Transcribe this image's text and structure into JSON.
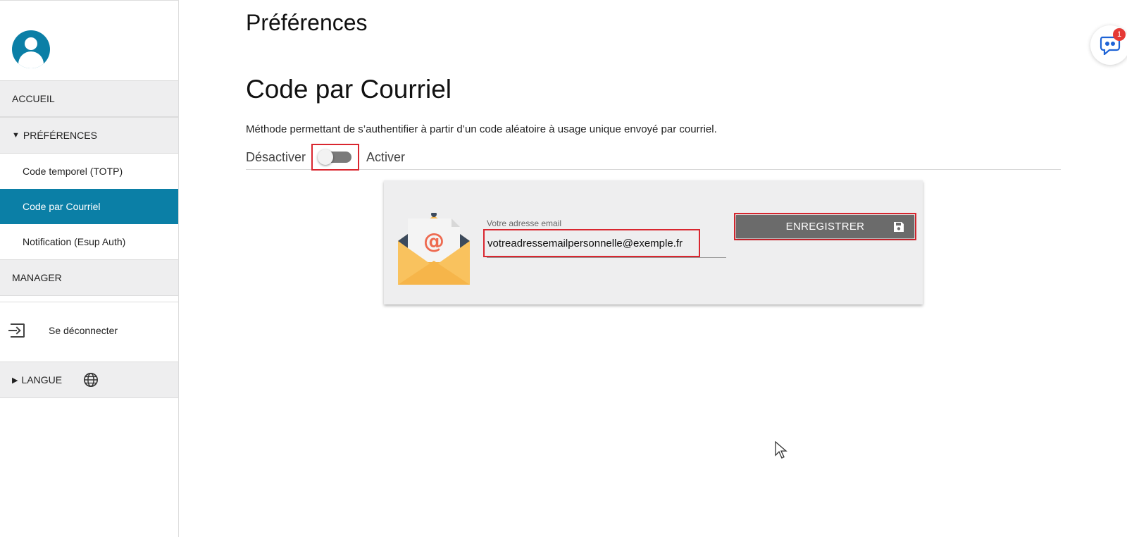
{
  "sidebar": {
    "accueil": "ACCUEIL",
    "preferences": "PRÉFÉRENCES",
    "items": [
      {
        "label": "Code temporel (TOTP)"
      },
      {
        "label": "Code par Courriel"
      },
      {
        "label": "Notification (Esup Auth)"
      }
    ],
    "manager": "MANAGER",
    "logout": "Se déconnecter",
    "langue": "LANGUE"
  },
  "main": {
    "page_title": "Préférences",
    "section_title": "Code par Courriel",
    "description": "Méthode permettant de s’authentifier à partir d’un code aléatoire à usage unique envoyé par courriel.",
    "toggle": {
      "off_label": "Désactiver",
      "on_label": "Activer",
      "enabled": false
    },
    "email_field": {
      "label": "Votre adresse email",
      "value": "votreadressemailpersonnelle@exemple.fr"
    },
    "save_button": "ENREGISTRER"
  },
  "chat": {
    "badge": "1"
  },
  "colors": {
    "accent": "#0b7fa6",
    "highlight": "#d9262f",
    "button": "#6b6b6b"
  }
}
